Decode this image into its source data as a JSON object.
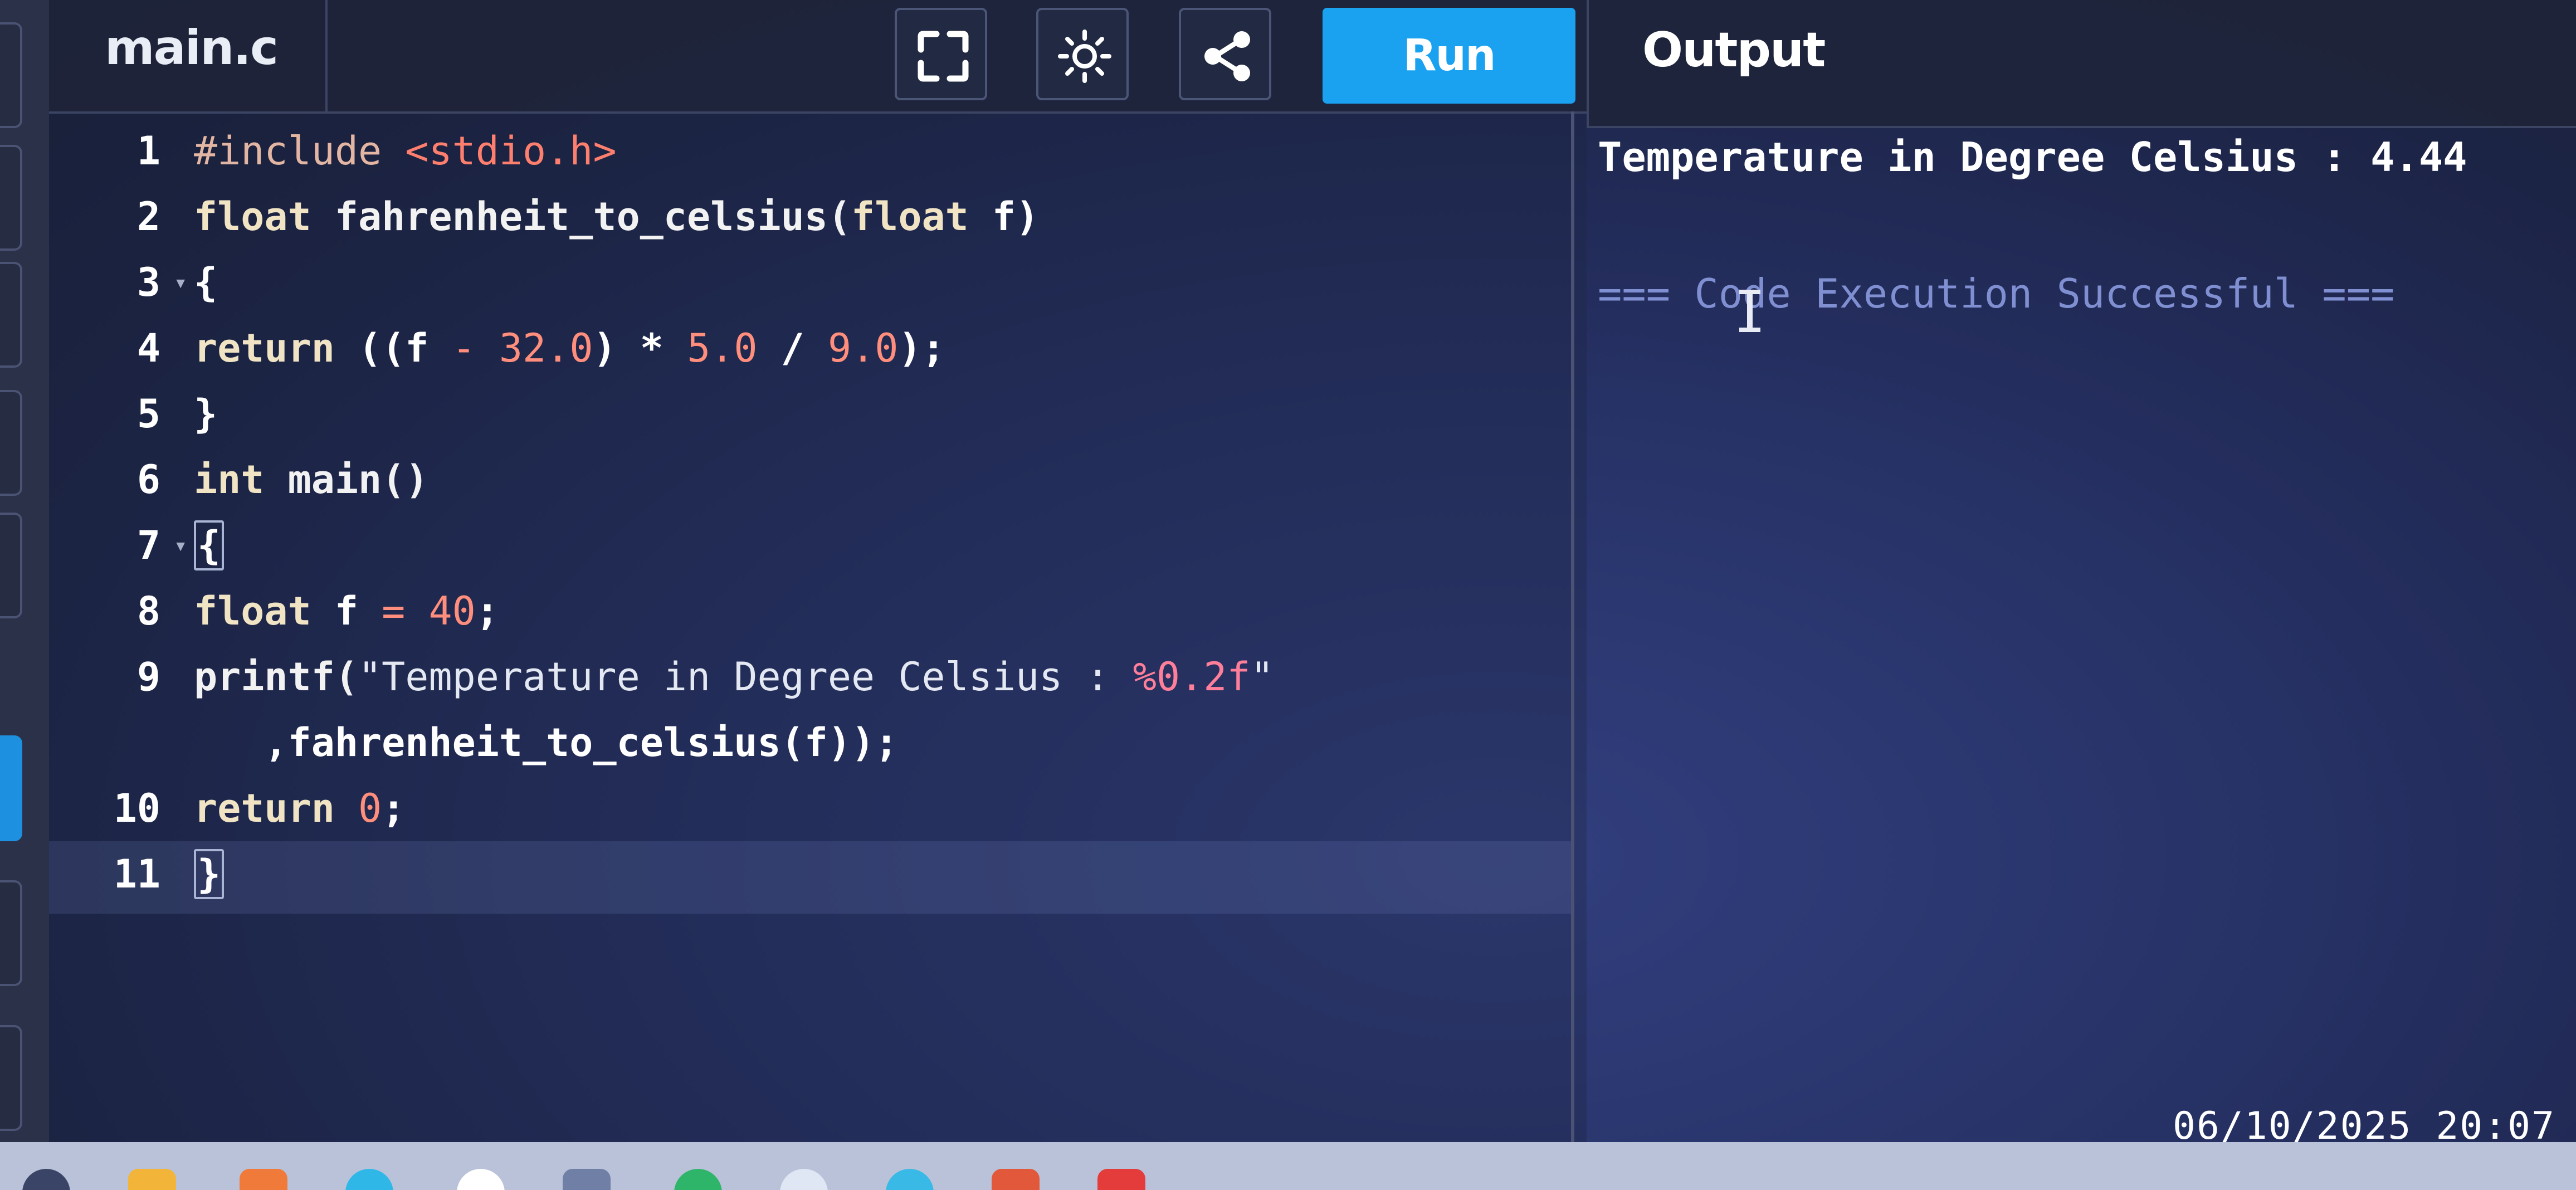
{
  "editor": {
    "file_name": "main.c",
    "run_label": "Run",
    "lines": [
      {
        "number": "1",
        "fold": false,
        "tokens": [
          {
            "t": "#include ",
            "c": "pp"
          },
          {
            "t": "<stdio.h>",
            "c": "inc"
          }
        ]
      },
      {
        "number": "2",
        "fold": false,
        "tokens": [
          {
            "t": "float",
            "c": "kw"
          },
          {
            "t": " fahrenheit_to_celsius(",
            "c": "fn"
          },
          {
            "t": "float",
            "c": "kw"
          },
          {
            "t": " f)",
            "c": "pl"
          }
        ]
      },
      {
        "number": "3",
        "fold": true,
        "tokens": [
          {
            "t": "{",
            "c": "pl"
          }
        ]
      },
      {
        "number": "4",
        "fold": false,
        "tokens": [
          {
            "t": "return",
            "c": "kw"
          },
          {
            "t": " ((f ",
            "c": "pl"
          },
          {
            "t": "-",
            "c": "num"
          },
          {
            "t": " ",
            "c": "pl"
          },
          {
            "t": "32.0",
            "c": "num"
          },
          {
            "t": ") * ",
            "c": "pl"
          },
          {
            "t": "5.0",
            "c": "num"
          },
          {
            "t": " / ",
            "c": "pl"
          },
          {
            "t": "9.0",
            "c": "num"
          },
          {
            "t": ");",
            "c": "pl"
          }
        ]
      },
      {
        "number": "5",
        "fold": false,
        "tokens": [
          {
            "t": "}",
            "c": "pl"
          }
        ]
      },
      {
        "number": "6",
        "fold": false,
        "tokens": [
          {
            "t": "int",
            "c": "kw"
          },
          {
            "t": " main()",
            "c": "fn"
          }
        ]
      },
      {
        "number": "7",
        "fold": true,
        "tokens": [
          {
            "t": "{",
            "c": "brace"
          }
        ]
      },
      {
        "number": "8",
        "fold": false,
        "tokens": [
          {
            "t": "float",
            "c": "kw"
          },
          {
            "t": " f ",
            "c": "pl"
          },
          {
            "t": "=",
            "c": "num"
          },
          {
            "t": " ",
            "c": "pl"
          },
          {
            "t": "40",
            "c": "num"
          },
          {
            "t": ";",
            "c": "pl"
          }
        ]
      },
      {
        "number": "9",
        "fold": false,
        "tokens": [
          {
            "t": "printf(",
            "c": "fn"
          },
          {
            "t": "\"Temperature in Degree Celsius : ",
            "c": "str"
          },
          {
            "t": "%0.2f",
            "c": "fmt"
          },
          {
            "t": "\"",
            "c": "str"
          }
        ]
      },
      {
        "number": "",
        "fold": false,
        "tokens": [
          {
            "t": "   ,fahrenheit_to_celsius(f));",
            "c": "pl"
          }
        ]
      },
      {
        "number": "10",
        "fold": false,
        "tokens": [
          {
            "t": "return",
            "c": "kw"
          },
          {
            "t": " ",
            "c": "pl"
          },
          {
            "t": "0",
            "c": "num"
          },
          {
            "t": ";",
            "c": "pl"
          }
        ]
      },
      {
        "number": "11",
        "fold": false,
        "tokens": [
          {
            "t": "}",
            "c": "brace"
          }
        ]
      }
    ]
  },
  "output": {
    "title": "Output",
    "line_1": "Temperature in Degree Celsius : 4.44",
    "line_2": "=== Code Execution Successful ==="
  },
  "toolbar": {
    "icons": [
      "fullscreen-icon",
      "theme-icon",
      "share-icon"
    ]
  },
  "timestamp": "06/10/2025 20:07",
  "colors": {
    "accent": "#1aa1ef",
    "keyword": "#f0e4c4",
    "number": "#ff8e7d",
    "success": "#7f8fd1"
  }
}
